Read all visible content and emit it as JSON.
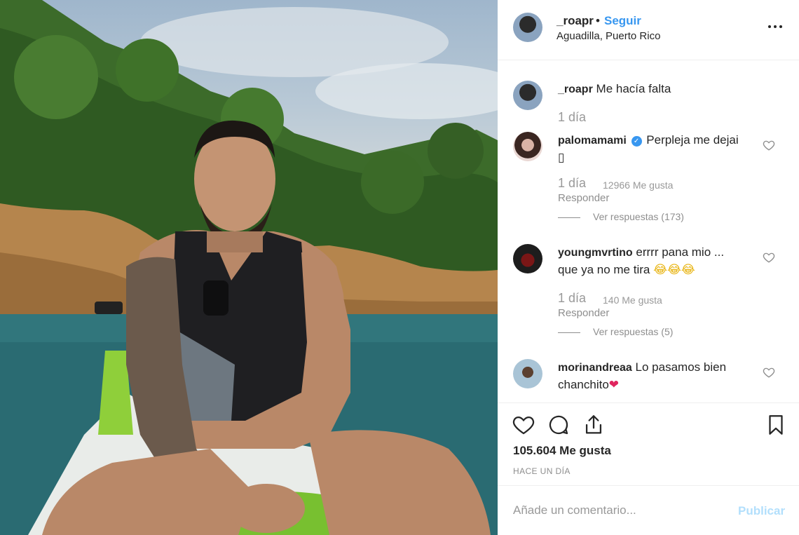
{
  "post": {
    "username": "_roapr",
    "follow_label": "Seguir",
    "separator": "•",
    "location": "Aguadilla, Puerto Rico",
    "caption": "Me hacía falta",
    "caption_time": "1 día",
    "likes": "105.604 Me gusta",
    "time_ago": "HACE UN DÍA"
  },
  "comments": [
    {
      "username": "palomamami",
      "verified": true,
      "text_line1": "Perpleja me dejai",
      "text_line2": "▯",
      "time": "1 día",
      "likes": "12966 Me gusta",
      "reply": "Responder",
      "view_replies": "Ver respuestas (173)"
    },
    {
      "username": "youngmvrtino",
      "verified": false,
      "text_line1": "errrr pana mio ...",
      "text_line2": "que ya no me tira",
      "emojis": "😂😂😂",
      "time": "1 día",
      "likes": "140 Me gusta",
      "reply": "Responder",
      "view_replies": "Ver respuestas (5)"
    },
    {
      "username": "morinandreaa",
      "verified": false,
      "text_line1": "Lo pasamos bien",
      "text_line2": "chanchito",
      "emojis": "❤"
    }
  ],
  "add_comment": {
    "placeholder": "Añade un comentario...",
    "publish_label": "Publicar"
  },
  "icons": {
    "heart": "heart-icon",
    "comment": "comment-icon",
    "share": "share-icon",
    "save": "bookmark-icon",
    "more": "more-options-icon"
  },
  "colors": {
    "link": "#3897f0",
    "publish_disabled": "#b2dffc",
    "muted": "#8e8e8e",
    "verified": "#3897f0"
  }
}
